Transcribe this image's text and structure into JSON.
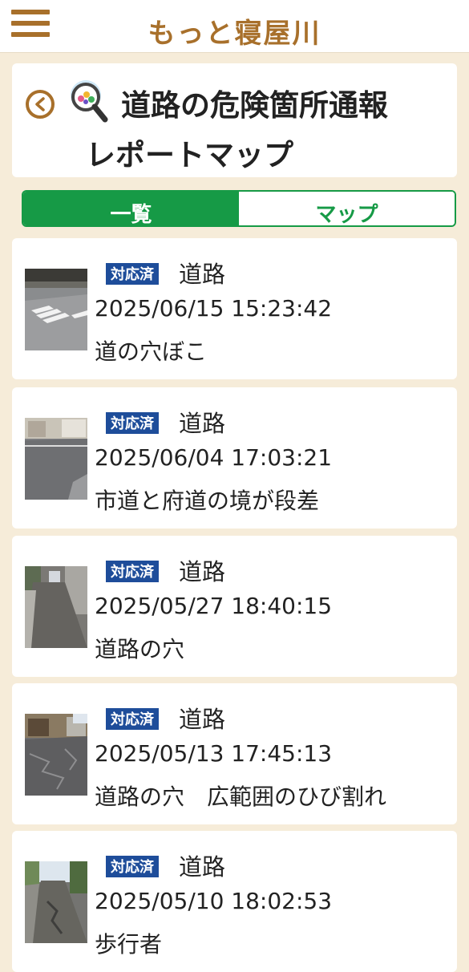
{
  "app": {
    "title": "もっと寝屋川"
  },
  "header": {
    "title_line1": "道路の危険箇所通報",
    "title_line2": "レポートマップ"
  },
  "tabs": [
    {
      "label": "一覧",
      "active": true
    },
    {
      "label": "マップ",
      "active": false
    }
  ],
  "reports": [
    {
      "status": "対応済",
      "category": "道路",
      "datetime": "2025/06/15 15:23:42",
      "description": "道の穴ぼこ"
    },
    {
      "status": "対応済",
      "category": "道路",
      "datetime": "2025/06/04 17:03:21",
      "description": "市道と府道の境が段差"
    },
    {
      "status": "対応済",
      "category": "道路",
      "datetime": "2025/05/27 18:40:15",
      "description": "道路の穴"
    },
    {
      "status": "対応済",
      "category": "道路",
      "datetime": "2025/05/13 17:45:13",
      "description": "道路の穴　広範囲のひび割れ"
    },
    {
      "status": "対応済",
      "category": "道路",
      "datetime": "2025/05/10 18:02:53",
      "description": "歩行者"
    }
  ],
  "colors": {
    "brand": "#a8702b",
    "tab_green": "#169a46",
    "badge_blue": "#1e4d9a",
    "background": "#f6ecd9"
  },
  "icons": {
    "menu": "hamburger-menu-icon",
    "back": "back-arrow-icon",
    "report": "magnifier-report-icon"
  }
}
